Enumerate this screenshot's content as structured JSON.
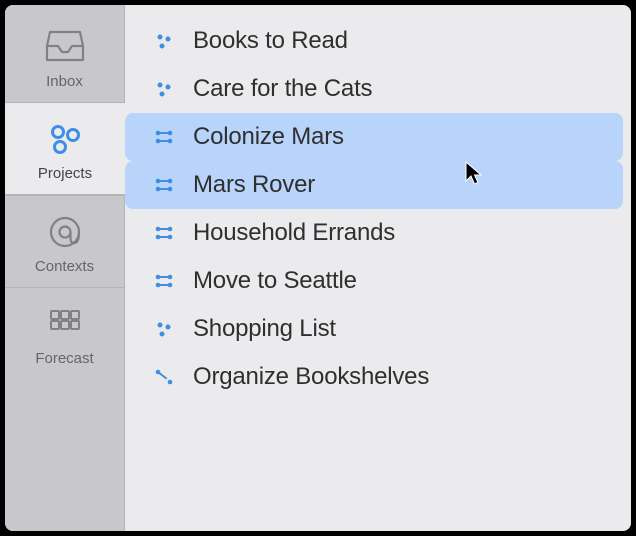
{
  "nav": {
    "items": [
      {
        "label": "Inbox",
        "icon": "inbox-icon",
        "active": false
      },
      {
        "label": "Projects",
        "icon": "projects-icon",
        "active": true
      },
      {
        "label": "Contexts",
        "icon": "contexts-icon",
        "active": false
      },
      {
        "label": "Forecast",
        "icon": "forecast-icon",
        "active": false
      }
    ]
  },
  "colors": {
    "accent": "#3d8ee6",
    "nav_icon": "#808086",
    "selection": "#b9d4fb"
  },
  "projects": {
    "items": [
      {
        "label": "Books to Read",
        "kind": "single",
        "selected": false
      },
      {
        "label": "Care for the Cats",
        "kind": "single",
        "selected": false
      },
      {
        "label": "Colonize Mars",
        "kind": "parallel",
        "selected": true
      },
      {
        "label": "Mars Rover",
        "kind": "parallel",
        "selected": true
      },
      {
        "label": "Household Errands",
        "kind": "parallel",
        "selected": false
      },
      {
        "label": "Move to Seattle",
        "kind": "parallel",
        "selected": false
      },
      {
        "label": "Shopping List",
        "kind": "single",
        "selected": false
      },
      {
        "label": "Organize Bookshelves",
        "kind": "sequential",
        "selected": false
      }
    ]
  }
}
